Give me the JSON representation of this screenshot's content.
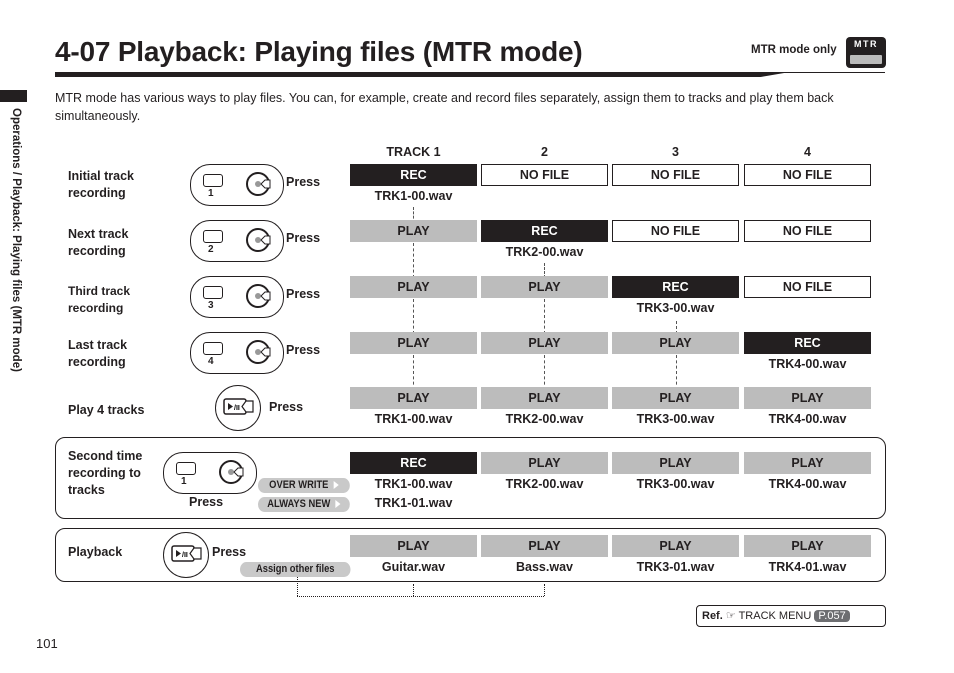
{
  "header": {
    "title": "4-07   Playback: Playing files (MTR mode)",
    "mode_note": "MTR mode only",
    "mode_badge": "MTR"
  },
  "side_tab": {
    "text": "Operations / Playback: Playing files (MTR mode)"
  },
  "intro": "MTR mode has various ways to play files. You can, for example, create and record files separately, assign them to tracks and play them back simultaneously.",
  "columns": [
    "TRACK 1",
    "2",
    "3",
    "4"
  ],
  "press_label": "Press",
  "steps": [
    {
      "label": "Initial track recording",
      "button": "1",
      "states": [
        "REC",
        "NO FILE",
        "NO FILE",
        "NO FILE"
      ],
      "files": [
        "TRK1-00.wav",
        "",
        "",
        ""
      ]
    },
    {
      "label": "Next track recording",
      "button": "2",
      "states": [
        "PLAY",
        "REC",
        "NO FILE",
        "NO FILE"
      ],
      "files": [
        "",
        "TRK2-00.wav",
        "",
        ""
      ]
    },
    {
      "label": "Third track recording",
      "button": "3",
      "states": [
        "PLAY",
        "PLAY",
        "REC",
        "NO FILE"
      ],
      "files": [
        "",
        "",
        "TRK3-00.wav",
        ""
      ]
    },
    {
      "label": "Last track recording",
      "button": "4",
      "states": [
        "PLAY",
        "PLAY",
        "PLAY",
        "REC"
      ],
      "files": [
        "",
        "",
        "",
        "TRK4-00.wav"
      ]
    },
    {
      "label": "Play 4 tracks",
      "button": "play",
      "states": [
        "PLAY",
        "PLAY",
        "PLAY",
        "PLAY"
      ],
      "files": [
        "TRK1-00.wav",
        "TRK2-00.wav",
        "TRK3-00.wav",
        "TRK4-00.wav"
      ]
    }
  ],
  "second_time": {
    "label": "Second time recording to tracks",
    "button": "1",
    "options": [
      "OVER WRITE",
      "ALWAYS NEW"
    ],
    "states": [
      "REC",
      "PLAY",
      "PLAY",
      "PLAY"
    ],
    "files": [
      "TRK1-00.wav",
      "TRK2-00.wav",
      "TRK3-00.wav",
      "TRK4-00.wav"
    ],
    "extra_file": "TRK1-01.wav"
  },
  "playback": {
    "label": "Playback",
    "assign_label": "Assign other files",
    "states": [
      "PLAY",
      "PLAY",
      "PLAY",
      "PLAY"
    ],
    "files": [
      "Guitar.wav",
      "Bass.wav",
      "TRK3-01.wav",
      "TRK4-01.wav"
    ]
  },
  "ref": {
    "prefix": "Ref.",
    "icon": "pointing-hand-icon",
    "menu": "TRACK MENU",
    "page": "P.057"
  },
  "page_number": "101"
}
